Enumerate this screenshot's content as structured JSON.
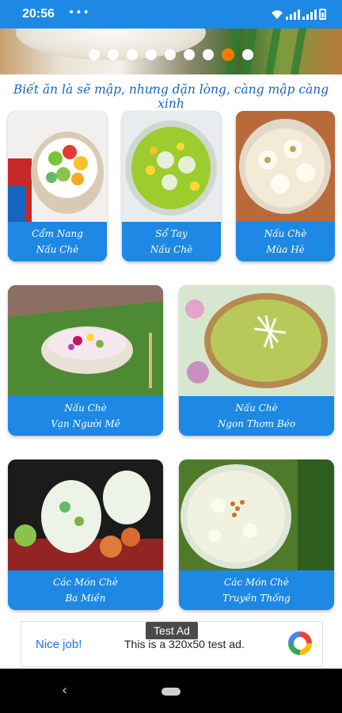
{
  "status_bar": {
    "time": "20:56",
    "overflow": "•••",
    "icons": [
      "wifi-icon",
      "signal-icon",
      "signal-icon",
      "battery-icon"
    ]
  },
  "carousel": {
    "dot_count": 9,
    "active_index": 7
  },
  "slogan": "Biết ăn là sẽ mập, nhưng dặn lòng, càng mập càng xinh",
  "cards": [
    {
      "line1": "Cẩm Nang",
      "line2": "Nấu Chè"
    },
    {
      "line1": "Sổ Tay",
      "line2": "Nấu Chè"
    },
    {
      "line1": "Nấu Chè",
      "line2": "Mùa Hè"
    },
    {
      "line1": "Nấu Chè",
      "line2": "Vạn Người Mê"
    },
    {
      "line1": "Nấu Chè",
      "line2": "Ngon Thơm Béo"
    },
    {
      "line1": "Các Món Chè",
      "line2": "Ba Miền"
    },
    {
      "line1": "Các Món Chè",
      "line2": "Truyền Thống"
    }
  ],
  "ad": {
    "tag": "Test Ad",
    "headline": "Nice job!",
    "body": "This is a 320x50 test ad."
  },
  "colors": {
    "primary": "#1e88e5",
    "accent": "#f57c00",
    "slogan": "#1565c0"
  }
}
